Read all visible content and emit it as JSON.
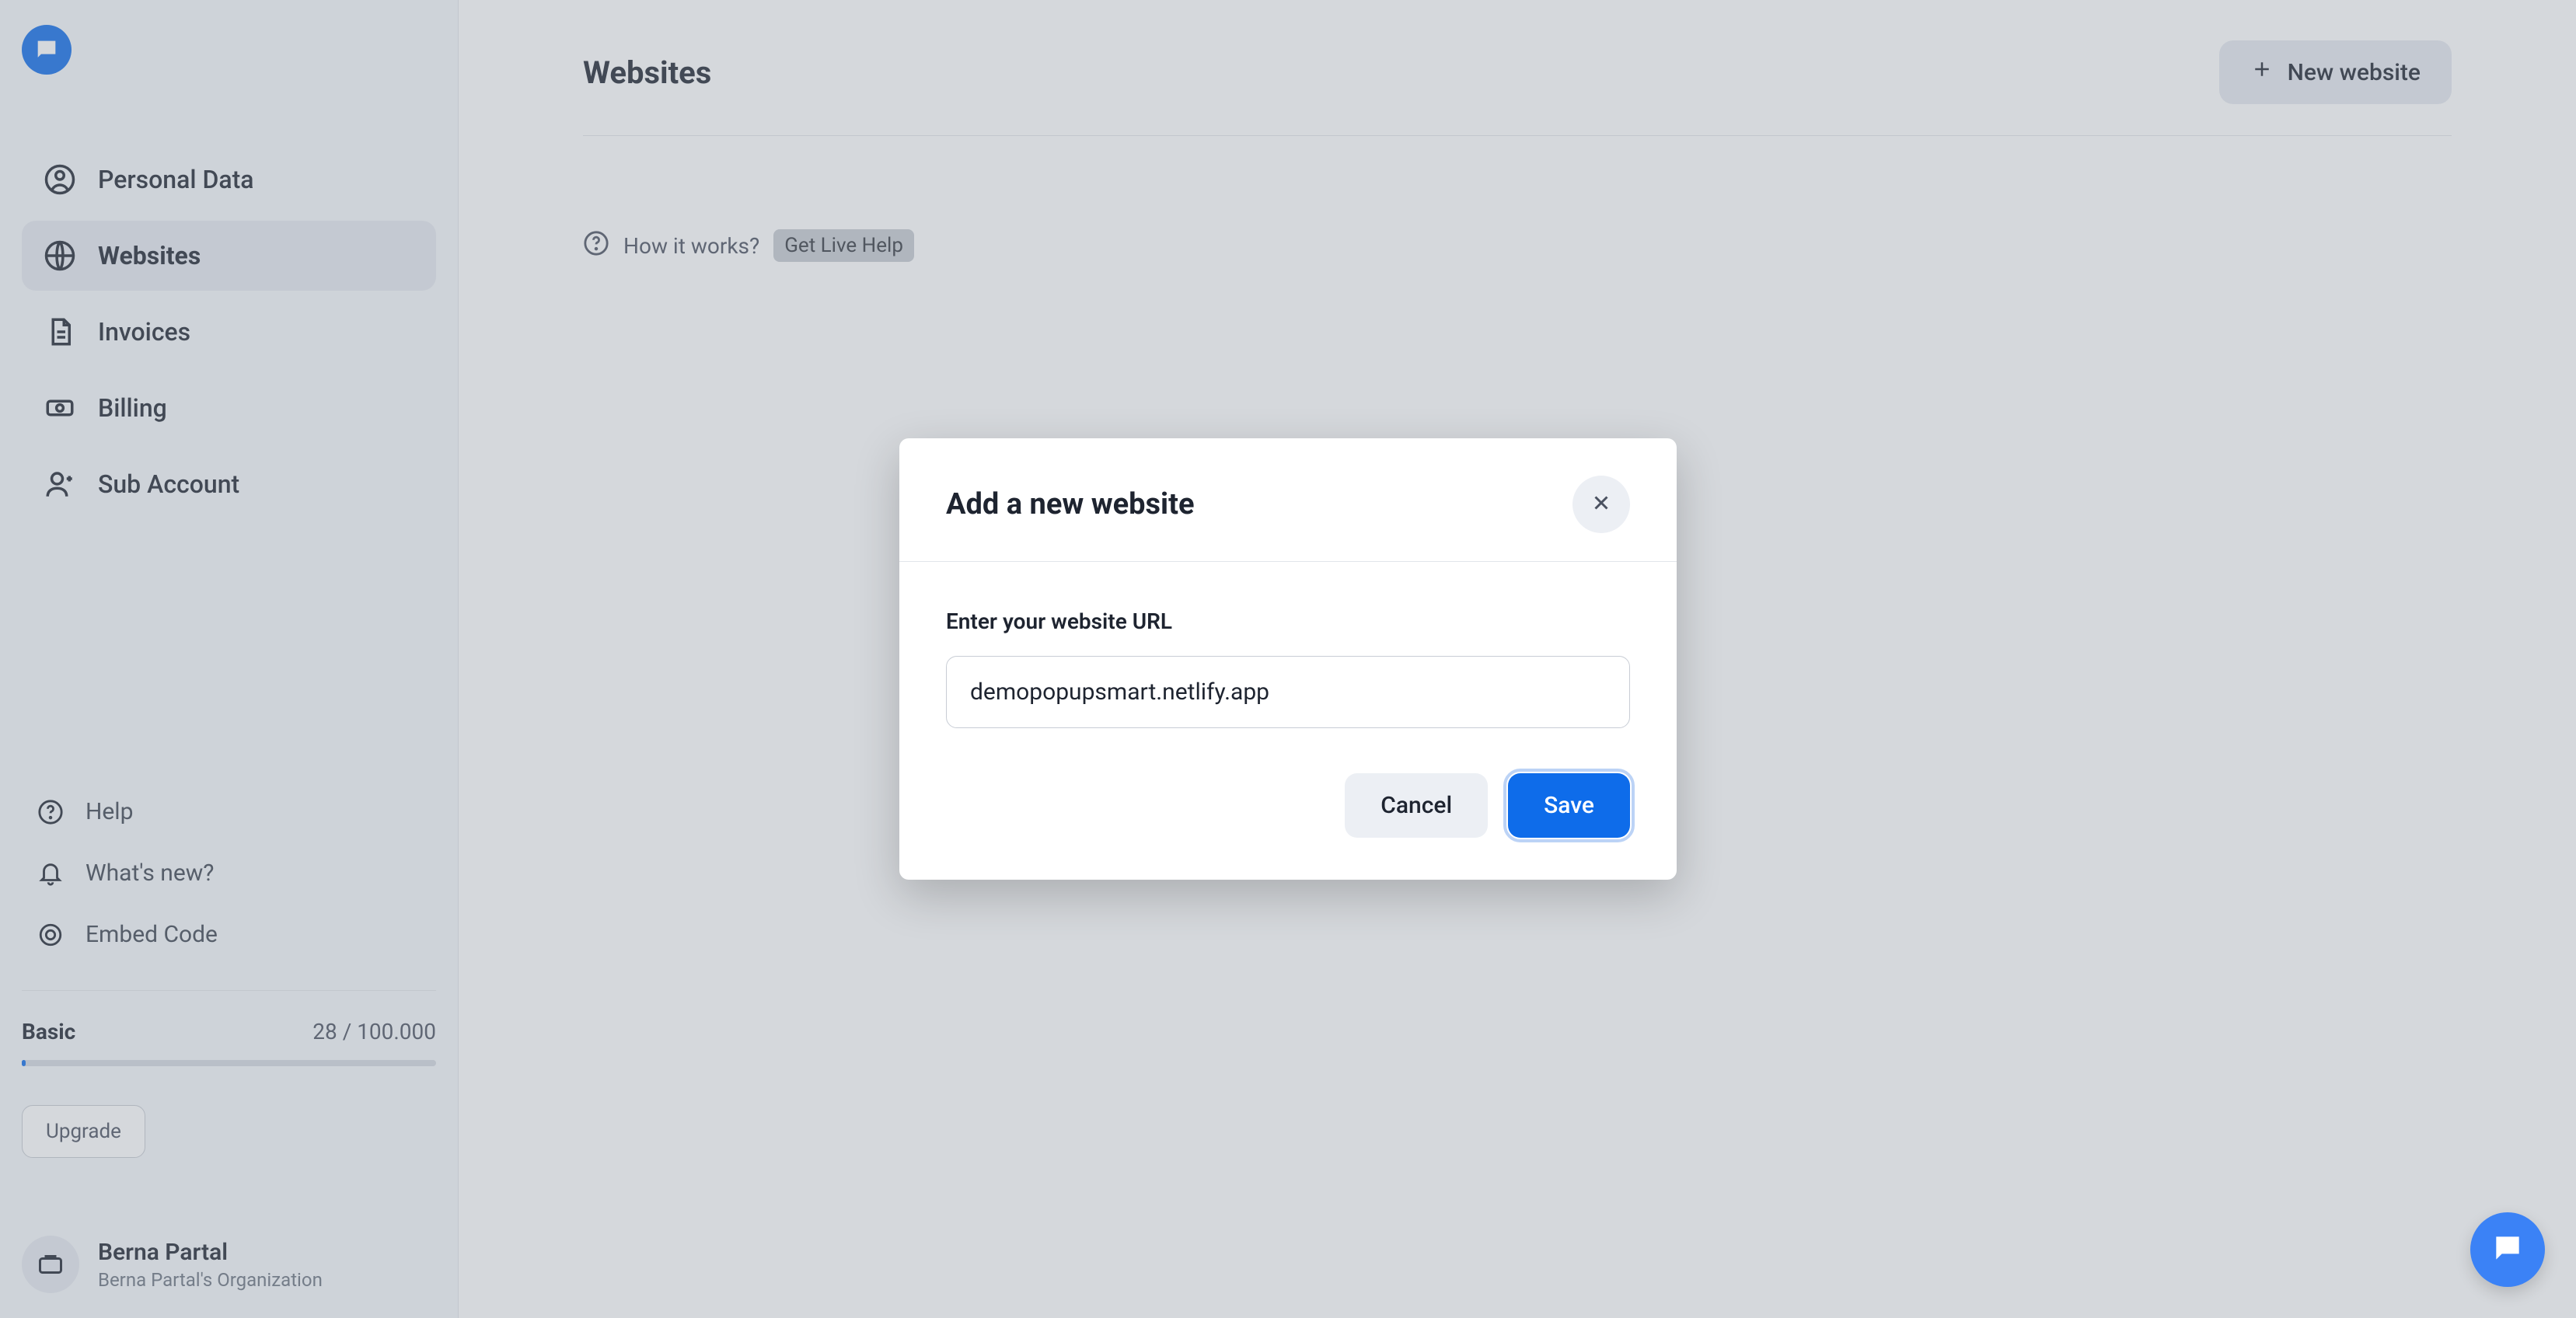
{
  "sidebar": {
    "items": [
      {
        "label": "Personal Data",
        "name": "sidebar-item-personal-data"
      },
      {
        "label": "Websites",
        "name": "sidebar-item-websites",
        "active": true
      },
      {
        "label": "Invoices",
        "name": "sidebar-item-invoices"
      },
      {
        "label": "Billing",
        "name": "sidebar-item-billing"
      },
      {
        "label": "Sub Account",
        "name": "sidebar-item-sub-account"
      }
    ],
    "secondary": [
      {
        "label": "Help",
        "name": "sidebar-item-help"
      },
      {
        "label": "What's new?",
        "name": "sidebar-item-whats-new"
      },
      {
        "label": "Embed Code",
        "name": "sidebar-item-embed-code"
      }
    ],
    "plan": {
      "name": "Basic",
      "usage": "28 / 100.000"
    },
    "upgrade_label": "Upgrade",
    "user": {
      "name": "Berna Partal",
      "org": "Berna Partal's Organization"
    }
  },
  "main": {
    "title": "Websites",
    "new_button": "New website",
    "help": {
      "text": "How it works?",
      "live": "Get Live Help"
    }
  },
  "modal": {
    "title": "Add a new website",
    "field_label": "Enter your website URL",
    "field_value": "demopopupsmart.netlify.app",
    "cancel": "Cancel",
    "save": "Save"
  }
}
